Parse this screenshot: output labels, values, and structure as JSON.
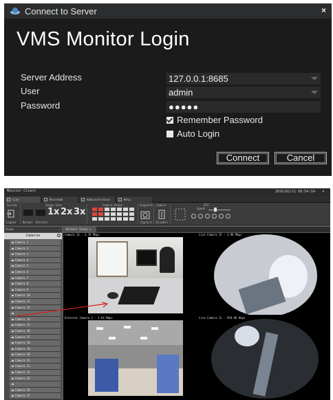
{
  "login": {
    "window_title": "Connect to Server",
    "close_label": "×",
    "heading": "VMS Monitor Login",
    "server_address_label": "Server Address",
    "server_address_value": "127.0.0.1:8685",
    "user_label": "User",
    "user_value": "admin",
    "password_label": "Password",
    "password_value": "●●●●●",
    "remember_label": "Remember Password",
    "remember_checked": true,
    "auto_login_label": "Auto Login",
    "auto_login_checked": false,
    "connect_label": "Connect",
    "cancel_label": "Cancel"
  },
  "client": {
    "title": "Monitor Client",
    "datetime": "2016/02/11 09:54:16",
    "tabs": [
      "Live",
      "Recorded",
      "Administration",
      "Help"
    ],
    "toolbar": {
      "system_label": "System",
      "logout_label": "Logout",
      "image_size_label": "Image Size",
      "normal_label": "Normal",
      "stretch_label": "Stretch",
      "x1_label": "1x",
      "x2_label": "2x",
      "x3_label": "3x",
      "camera_views_label": "Camera Views",
      "snapshot_label": "Snapshot",
      "capture_label": "Capture",
      "camera_label": "Camera",
      "disable_label": "Disable",
      "ptz_label": "PTZ",
      "speed_label": "Speed"
    },
    "views_label": "Views",
    "cameras_header": "Cameras",
    "view_tab": "Default View1",
    "cameras": [
      "Camera 1",
      "Camera 2",
      "Camera 3",
      "Camera 4",
      "Camera 5",
      "Camera 6",
      "Camera 7",
      "Camera 8",
      "Camera 9",
      "Camera 10",
      "Camera 11",
      "Camera 12",
      "",
      "Camera 14",
      "Camera 15",
      "Camera 16",
      "Camera 17",
      "Camera 18",
      "Camera 19",
      "Camera 20",
      "Camera 21",
      "Camera 22",
      "Camera 23",
      "Camera 24",
      "",
      "Camera 26",
      "Camera 27"
    ],
    "video_captions": [
      "Camera 13 - 2.76 Mbps",
      "Live Camera 25 - 2.96 Mbps",
      "External Camera 3 - 3.64 Mbps",
      "Live Camera 12 - 928.96 Kbps"
    ]
  }
}
